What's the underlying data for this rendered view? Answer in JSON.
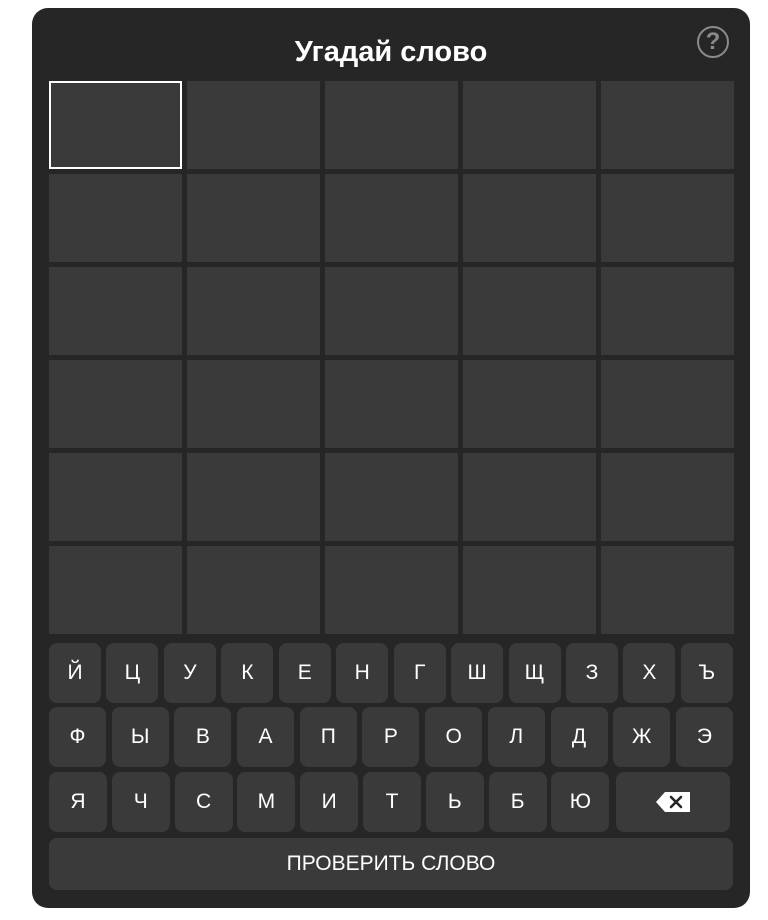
{
  "game": {
    "title": "Угадай слово",
    "help_label": "?"
  },
  "board": {
    "rows": 6,
    "cols": 5,
    "active_cell": [
      0,
      0
    ],
    "letters": [
      [
        "",
        "",
        "",
        "",
        ""
      ],
      [
        "",
        "",
        "",
        "",
        ""
      ],
      [
        "",
        "",
        "",
        "",
        ""
      ],
      [
        "",
        "",
        "",
        "",
        ""
      ],
      [
        "",
        "",
        "",
        "",
        ""
      ],
      [
        "",
        "",
        "",
        "",
        ""
      ]
    ]
  },
  "keyboard": {
    "rows": [
      [
        "Й",
        "Ц",
        "У",
        "К",
        "Е",
        "Н",
        "Г",
        "Ш",
        "Щ",
        "З",
        "Х",
        "Ъ"
      ],
      [
        "Ф",
        "Ы",
        "В",
        "А",
        "П",
        "Р",
        "О",
        "Л",
        "Д",
        "Ж",
        "Э"
      ],
      [
        "Я",
        "Ч",
        "С",
        "М",
        "И",
        "Т",
        "Ь",
        "Б",
        "Ю"
      ]
    ],
    "backspace_icon": "backspace-icon"
  },
  "actions": {
    "check_label": "ПРОВЕРИТЬ СЛОВО"
  },
  "colors": {
    "panel": "#262626",
    "tile": "#3a3a3a",
    "active_border": "#ffffff",
    "text": "#ffffff",
    "help_icon": "#8a8a8a"
  }
}
